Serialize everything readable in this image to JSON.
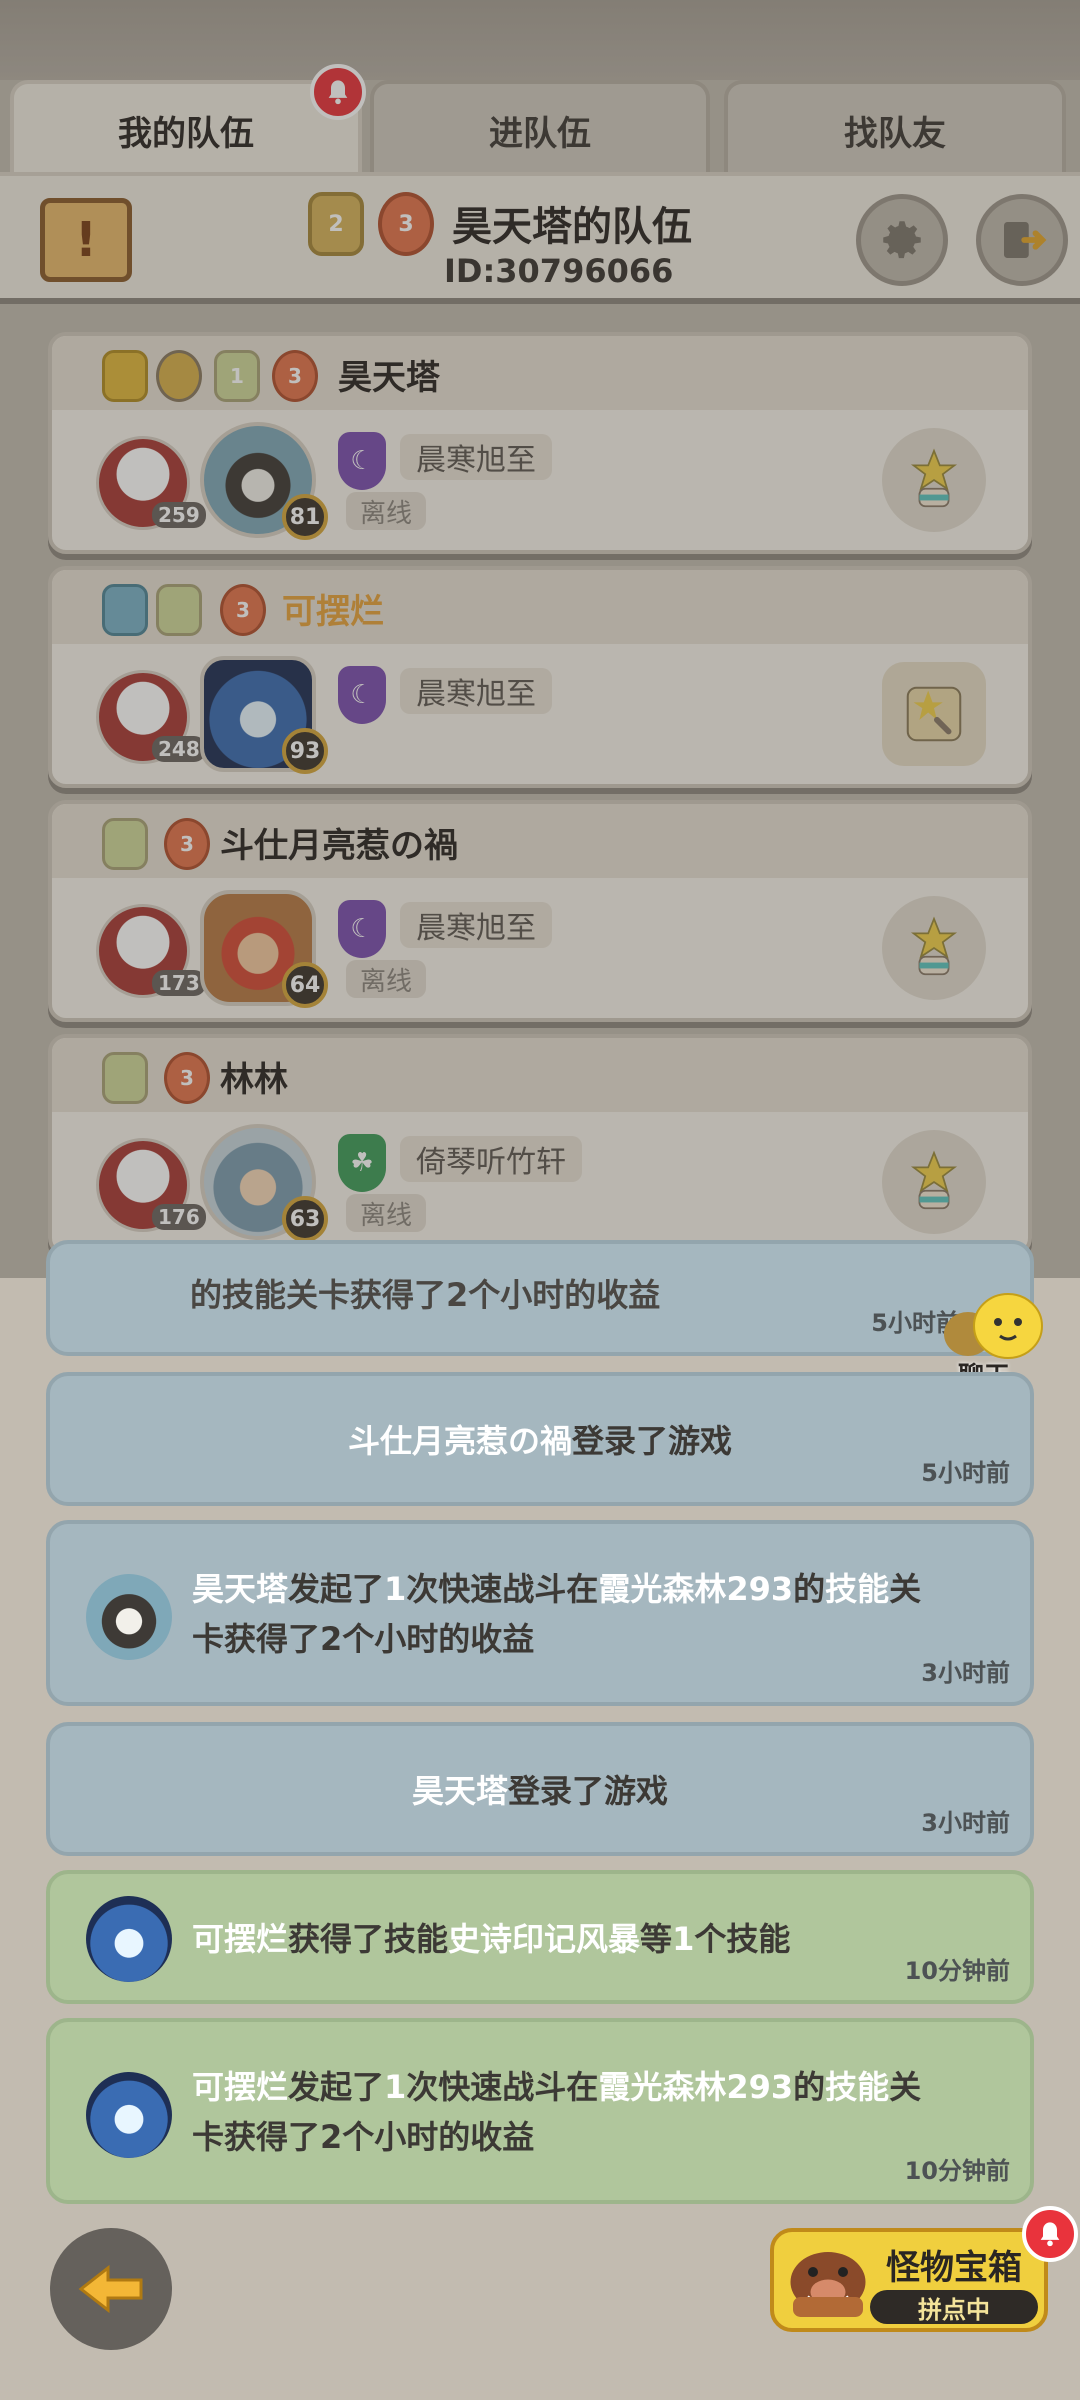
{
  "tabs": [
    {
      "label": "我的队伍",
      "active": true
    },
    {
      "label": "进队伍",
      "active": false
    },
    {
      "label": "找队友",
      "active": false
    }
  ],
  "team": {
    "name": "昊天塔的队伍",
    "id": "ID:30796066",
    "badges": [
      "2",
      "3"
    ]
  },
  "members": [
    {
      "name": "昊天塔",
      "name_color": "normal",
      "badges": [
        "",
        "",
        "1",
        "3"
      ],
      "cat_level": "259",
      "pet_level": "81",
      "guild_name": "晨寒旭至",
      "guild_color": "#7b4fb0",
      "status": "离线"
    },
    {
      "name": "可摆烂",
      "name_color": "orange",
      "badges": [
        "",
        "",
        "3"
      ],
      "cat_level": "248",
      "pet_level": "93",
      "guild_name": "晨寒旭至",
      "guild_color": "#7b4fb0",
      "status": ""
    },
    {
      "name": "斗仕月亮惹の禍",
      "name_color": "normal",
      "badges": [
        "",
        "3"
      ],
      "cat_level": "173",
      "pet_level": "64",
      "guild_name": "晨寒旭至",
      "guild_color": "#7b4fb0",
      "status": "离线"
    },
    {
      "name": "林林",
      "name_color": "normal",
      "badges": [
        "",
        "3"
      ],
      "cat_level": "176",
      "pet_level": "63",
      "guild_name": "倚琴听竹轩",
      "guild_color": "#3f9c5a",
      "status": "离线"
    }
  ],
  "partial_msg": {
    "text": "的技能关卡获得了2个小时的收益",
    "time": "5小时前"
  },
  "messages": [
    {
      "type": "blue",
      "parts": [
        {
          "t": "斗仕月亮惹の禍",
          "w": true
        },
        {
          "t": "登录了游戏",
          "w": false
        }
      ],
      "time": "5小时前"
    },
    {
      "type": "blue",
      "line1": [
        {
          "t": "昊天塔",
          "w": true
        },
        {
          "t": "发起了",
          "w": false
        },
        {
          "t": "1",
          "w": true
        },
        {
          "t": "次快速战斗在",
          "w": false
        },
        {
          "t": "霞光森林293",
          "w": true
        },
        {
          "t": "的",
          "w": false
        },
        {
          "t": "技能",
          "w": true
        },
        {
          "t": "关",
          "w": false
        }
      ],
      "line2": "卡获得了2个小时的收益",
      "time": "3小时前"
    },
    {
      "type": "blue",
      "parts": [
        {
          "t": "昊天塔",
          "w": true
        },
        {
          "t": "登录了游戏",
          "w": false
        }
      ],
      "time": "3小时前"
    },
    {
      "type": "green",
      "parts": [
        {
          "t": "可摆烂",
          "w": true
        },
        {
          "t": "获得了技能",
          "w": false
        },
        {
          "t": "史诗印记风暴",
          "w": true
        },
        {
          "t": "等",
          "w": false
        },
        {
          "t": "1",
          "w": true
        },
        {
          "t": "个技能",
          "w": false
        }
      ],
      "time": "10分钟前"
    },
    {
      "type": "green",
      "line1": [
        {
          "t": "可摆烂",
          "w": true
        },
        {
          "t": "发起了",
          "w": false
        },
        {
          "t": "1",
          "w": true
        },
        {
          "t": "次快速战斗在",
          "w": false
        },
        {
          "t": "霞光森林293",
          "w": true
        },
        {
          "t": "的",
          "w": false
        },
        {
          "t": "技能",
          "w": true
        },
        {
          "t": "关",
          "w": false
        }
      ],
      "line2": "卡获得了2个小时的收益",
      "time": "10分钟前"
    }
  ],
  "chat": {
    "label": "聊天"
  },
  "chest": {
    "title": "怪物宝箱",
    "subtitle": "拼点中"
  },
  "colors": {
    "accent_orange": "#e6a23c",
    "notif_red": "#e9333c"
  }
}
